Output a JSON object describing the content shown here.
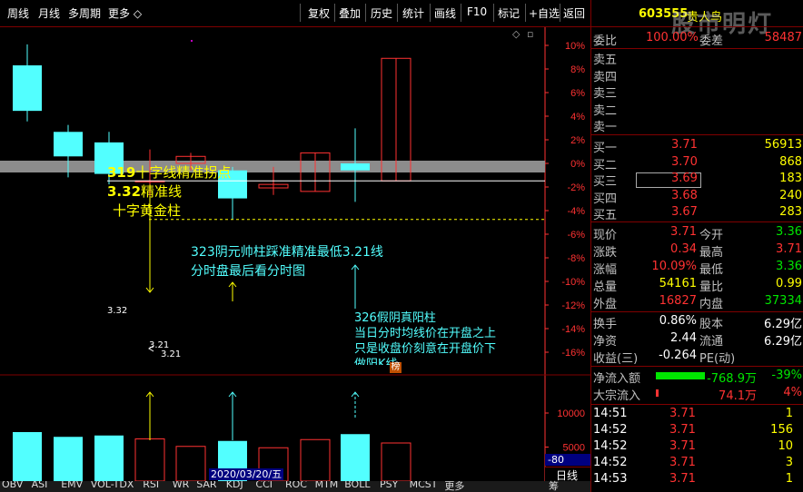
{
  "topbar": {
    "left_items": [
      "周线",
      "月线",
      "多周期",
      "更多"
    ],
    "right_items": [
      "复权",
      "叠加",
      "历史",
      "统计",
      "画线",
      "F10",
      "标记",
      "+自选",
      "返回"
    ]
  },
  "chart": {
    "pct_ticks": [
      "10%",
      "8%",
      "6%",
      "4%",
      "2%",
      "0%",
      "-2%",
      "-4%",
      "-6%",
      "-8%",
      "-10%",
      "-12%",
      "-14%",
      "-16%"
    ],
    "vol_ticks": [
      "10000",
      "5000"
    ],
    "vol_indicator": "-80",
    "date_label": "2020/03/20/五",
    "annotations": {
      "line1_hl": "319",
      "line1": "十字线精准拐点",
      "line2_hl": "3.32",
      "line2": "精准线",
      "line3": "十字黄金柱",
      "note1": "323阴元帅柱踩准精准最低3.21线",
      "note2": "分时盘最后看分时图",
      "note3": "326假阴真阳柱",
      "note4": "当日分时均线价在开盘之上",
      "note5": "只是收盘价刻意在开盘价下",
      "note6": "做阳K线"
    },
    "price_labels": {
      "p332": "3.32",
      "p321a": "3.21",
      "p321b": "3.21"
    },
    "candles": [
      {
        "open": 3.65,
        "close": 3.52,
        "high": 3.71,
        "low": 3.49,
        "vol": 7200
      },
      {
        "open": 3.46,
        "close": 3.39,
        "high": 3.48,
        "low": 3.33,
        "vol": 6500
      },
      {
        "open": 3.43,
        "close": 3.34,
        "high": 3.46,
        "low": 3.31,
        "vol": 6700
      },
      {
        "open": 3.32,
        "close": 3.32,
        "high": 3.41,
        "low": 3.25,
        "vol": 6200
      },
      {
        "open": 3.37,
        "close": 3.39,
        "high": 3.4,
        "low": 3.35,
        "vol": 5100
      },
      {
        "open": 3.35,
        "close": 3.27,
        "high": 3.36,
        "low": 3.21,
        "vol": 5900
      },
      {
        "open": 3.3,
        "close": 3.31,
        "high": 3.36,
        "low": 3.28,
        "vol": 4900
      },
      {
        "open": 3.29,
        "close": 3.4,
        "high": 3.4,
        "low": 3.29,
        "vol": 6100
      },
      {
        "open": 3.37,
        "close": 3.35,
        "high": 3.47,
        "low": 3.26,
        "vol": 6900
      },
      {
        "open": 3.32,
        "close": 3.67,
        "high": 3.67,
        "low": 3.32,
        "vol": 5600
      }
    ],
    "indicator_label": "榜"
  },
  "quote": {
    "code": "603555",
    "name": "贵人鸟",
    "weibi_label": "委比",
    "weibi": "100.00%",
    "weicha_label": "委差",
    "weicha": "58487",
    "sells": [
      {
        "label": "卖五",
        "price": "",
        "vol": ""
      },
      {
        "label": "卖四",
        "price": "",
        "vol": ""
      },
      {
        "label": "卖三",
        "price": "",
        "vol": ""
      },
      {
        "label": "卖二",
        "price": "",
        "vol": ""
      },
      {
        "label": "卖一",
        "price": "",
        "vol": ""
      }
    ],
    "buys": [
      {
        "label": "买一",
        "price": "3.71",
        "vol": "56913"
      },
      {
        "label": "买二",
        "price": "3.70",
        "vol": "868"
      },
      {
        "label": "买三",
        "price": "3.69",
        "vol": "183"
      },
      {
        "label": "买四",
        "price": "3.68",
        "vol": "240"
      },
      {
        "label": "买五",
        "price": "3.67",
        "vol": "283"
      }
    ],
    "stats": [
      {
        "l1": "现价",
        "v1": "3.71",
        "c1": "red",
        "l2": "今开",
        "v2": "3.36",
        "c2": "green"
      },
      {
        "l1": "涨跌",
        "v1": "0.34",
        "c1": "red",
        "l2": "最高",
        "v2": "3.71",
        "c2": "red"
      },
      {
        "l1": "涨幅",
        "v1": "10.09%",
        "c1": "red",
        "l2": "最低",
        "v2": "3.36",
        "c2": "green"
      },
      {
        "l1": "总量",
        "v1": "54161",
        "c1": "yel",
        "l2": "量比",
        "v2": "0.99",
        "c2": "yel"
      },
      {
        "l1": "外盘",
        "v1": "16827",
        "c1": "red",
        "l2": "内盘",
        "v2": "37334",
        "c2": "green"
      }
    ],
    "fin": [
      {
        "l1": "换手",
        "v1": "0.86%",
        "l2": "股本",
        "v2": "6.29亿"
      },
      {
        "l1": "净资",
        "v1": "2.44",
        "l2": "流通",
        "v2": "6.29亿"
      },
      {
        "l1": "收益(三)",
        "v1": "-0.264",
        "l2": "PE(动)",
        "v2": ""
      }
    ],
    "flow": [
      {
        "label": "净流入额",
        "value": "-768.9万",
        "pct": "-39%",
        "color": "green"
      },
      {
        "label": "大宗流入",
        "value": "74.1万",
        "pct": "4%",
        "color": "red"
      }
    ],
    "ticks": [
      {
        "time": "14:51",
        "price": "3.71",
        "vol": "1"
      },
      {
        "time": "14:52",
        "price": "3.71",
        "vol": "156"
      },
      {
        "time": "14:52",
        "price": "3.71",
        "vol": "10"
      },
      {
        "time": "14:52",
        "price": "3.71",
        "vol": "3"
      },
      {
        "time": "14:53",
        "price": "3.71",
        "vol": "1"
      }
    ],
    "watermark": "股市明灯"
  },
  "bottombar": {
    "tabs": [
      "OBV",
      "ASI",
      "EMV",
      "VOL-TDX",
      "RSI",
      "WR",
      "SAR",
      "KDJ",
      "CCI",
      "ROC",
      "MTM",
      "BOLL",
      "PSY",
      "MCST",
      "更多"
    ],
    "right_tab": "日线",
    "right_extra": "筹"
  },
  "colors": {
    "up": "#ff3232",
    "down": "#52ffff",
    "panel_border": "#800000",
    "axis": "#ff3232",
    "annot_yellow": "#ffff00",
    "annot_cyan": "#52ffff"
  }
}
